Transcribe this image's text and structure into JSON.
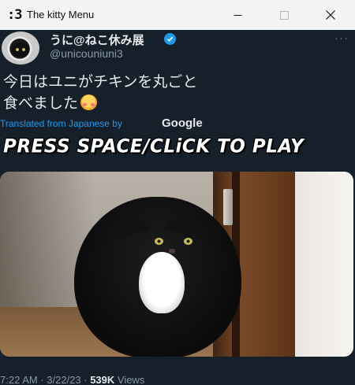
{
  "window": {
    "app_icon_text": ":3",
    "title": "The kitty Menu"
  },
  "tweet": {
    "display_name": "うに@ねこ休み展",
    "handle": "@unicouniuni3",
    "text_line1": "今日はユニがチキンを丸ごと",
    "text_line2": "食べました",
    "translated_label": "Translated from Japanese by",
    "translator": "Google",
    "meta_time_date": "7:22 AM · 3/22/23 · ",
    "meta_views_count": "539K",
    "meta_views_label": " Views"
  },
  "overlay": {
    "press_space_text": "PRESS SPACE/CLiCK TO PLAY"
  },
  "icons": {
    "verified": "verified-badge-icon",
    "more": "more-options-icon",
    "emoji": "smiling-face-with-hearts-icon"
  },
  "colors": {
    "background": "#15202b",
    "link": "#1d9bf0",
    "text": "#e7e9ea",
    "muted": "#8b98a5"
  }
}
